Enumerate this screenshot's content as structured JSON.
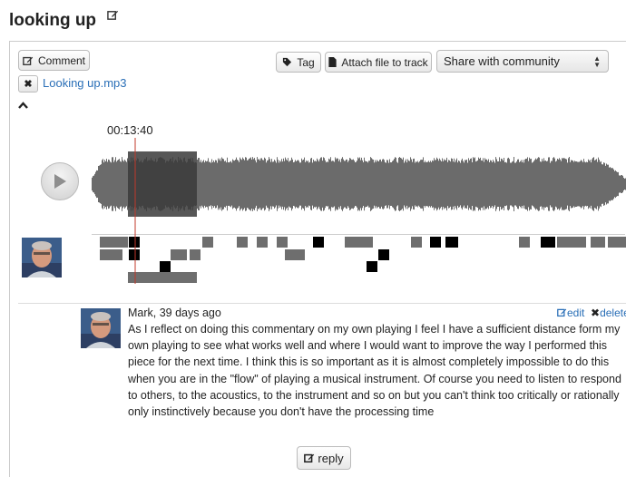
{
  "page": {
    "title": "looking up"
  },
  "toolbar": {
    "comment_label": "Comment",
    "tag_label": "Tag",
    "attach_label": "Attach file to track",
    "share_selected": "Share with community"
  },
  "file": {
    "name": "Looking up.mp3"
  },
  "player": {
    "time_display": "00:13:40",
    "playhead_seconds": 820
  },
  "comment": {
    "author_line": "Mark, 39 days ago",
    "edit_label": "edit",
    "delete_label": "delete",
    "body": "As I reflect on doing this commentary on my own playing I feel I have a sufficient distance form my own playing to see what works well and where I would want to improve the way I performed this piece for the next time. I think this is so important as it is almost completely impossible to do this when you are in the \"flow\" of playing a musical instrument. Of course you need to listen to respond to others, to the acoustics, to the instrument and so on but you can't think too critically or rationally only instinctively because you don't have the processing time"
  },
  "reply": {
    "label": "reply"
  },
  "colors": {
    "link": "#2a6fb7",
    "waveform": "#6b6b6b",
    "waveform_selected": "#3a3a3a",
    "playhead": "#c0392b",
    "marker_gray": "#6e6e6e",
    "marker_black": "#000000"
  },
  "icons": {
    "title_edit": "edit-icon",
    "comment": "edit-icon",
    "tag": "tag-icon",
    "attach": "file-icon",
    "remove_file": "close-icon",
    "collapse": "chevron-up-icon",
    "play": "play-icon",
    "reply": "reply-icon"
  }
}
